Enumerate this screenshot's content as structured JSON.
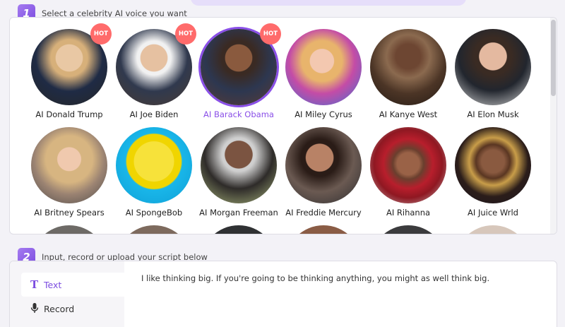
{
  "steps": {
    "step1": {
      "number": "1",
      "title": "Select a celebrity AI voice you want"
    },
    "step2": {
      "number": "2",
      "title": "Input, record or upload your script below"
    }
  },
  "hot_label": "HOT",
  "voices": [
    {
      "name": "AI Donald Trump",
      "hot": true,
      "selected": false
    },
    {
      "name": "AI Joe Biden",
      "hot": true,
      "selected": false
    },
    {
      "name": "AI Barack Obama",
      "hot": true,
      "selected": true
    },
    {
      "name": "AI Miley Cyrus",
      "hot": false,
      "selected": false
    },
    {
      "name": "AI Kanye West",
      "hot": false,
      "selected": false
    },
    {
      "name": "AI Elon Musk",
      "hot": false,
      "selected": false
    },
    {
      "name": "AI Britney Spears",
      "hot": false,
      "selected": false
    },
    {
      "name": "AI SpongeBob",
      "hot": false,
      "selected": false
    },
    {
      "name": "AI Morgan Freeman",
      "hot": false,
      "selected": false
    },
    {
      "name": "AI Freddie Mercury",
      "hot": false,
      "selected": false
    },
    {
      "name": "AI Rihanna",
      "hot": false,
      "selected": false
    },
    {
      "name": "AI Juice Wrld",
      "hot": false,
      "selected": false
    }
  ],
  "input_tabs": [
    {
      "label": "Text",
      "icon": "text-T-icon",
      "active": true
    },
    {
      "label": "Record",
      "icon": "microphone-icon",
      "active": false
    }
  ],
  "script_text": "I like thinking big. If you're going to be thinking anything, you might as well think big.",
  "colors": {
    "accent": "#8a4fe8",
    "hot": "#ff6b6b"
  }
}
